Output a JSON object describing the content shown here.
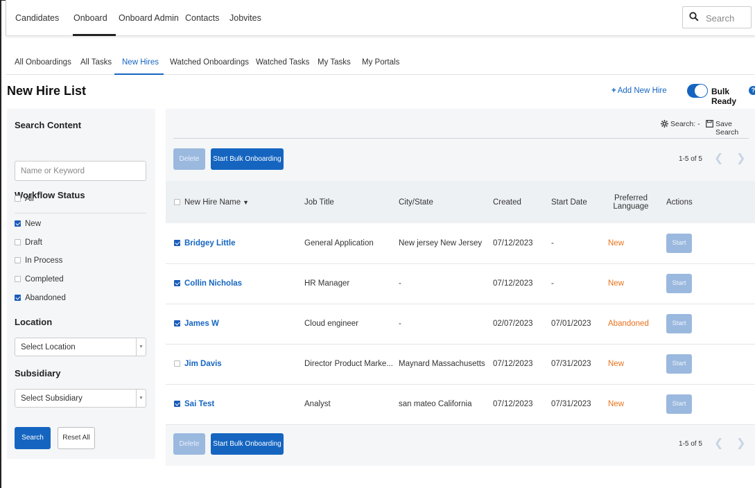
{
  "topnav": {
    "items": [
      "Candidates",
      "Onboard",
      "Onboard Admin",
      "Contacts",
      "Jobvites"
    ],
    "search_placeholder": "Search"
  },
  "subtabs": [
    "All Onboardings",
    "All Tasks",
    "New Hires",
    "Watched Onboardings",
    "Watched Tasks",
    "My Tasks",
    "My Portals"
  ],
  "active_subtab": "New Hires",
  "page_title": "New Hire List",
  "header_actions": {
    "add_new_hire": "Add New Hire",
    "bulk_ready": "Bulk Ready",
    "bulk_ready_on": true
  },
  "filters": {
    "search_content_label": "Search Content",
    "keyword_placeholder": "Name or Keyword",
    "workflow_status_label": "Workflow Status",
    "statuses": [
      {
        "label": "All",
        "checked": false
      },
      {
        "label": "New",
        "checked": true
      },
      {
        "label": "Draft",
        "checked": false
      },
      {
        "label": "In Process",
        "checked": false
      },
      {
        "label": "Completed",
        "checked": false
      },
      {
        "label": "Abandoned",
        "checked": true
      }
    ],
    "location_label": "Location",
    "location_value": "Select Location",
    "subsidiary_label": "Subsidiary",
    "subsidiary_value": "Select Subsidiary",
    "search_button": "Search",
    "reset_button": "Reset All"
  },
  "list": {
    "search_label": "Search: -",
    "save_search": "Save Search",
    "delete_button": "Delete",
    "start_bulk_button": "Start Bulk Onboarding",
    "pager": "1-5 of 5",
    "columns": {
      "name": "New Hire Name",
      "job_title": "Job Title",
      "city_state": "City/State",
      "created": "Created",
      "start_date": "Start Date",
      "preferred_language": "Preferred Language",
      "actions": "Actions"
    },
    "rows": [
      {
        "name": "Bridgey Little",
        "job_title": "General Application",
        "city_state": "New jersey New Jersey",
        "created": "07/12/2023",
        "start_date": "-",
        "status": "New",
        "action": "Start",
        "checked": true
      },
      {
        "name": "Collin Nicholas",
        "job_title": "HR Manager",
        "city_state": "-",
        "created": "07/12/2023",
        "start_date": "-",
        "status": "New",
        "action": "Start",
        "checked": true
      },
      {
        "name": "James W",
        "job_title": "Cloud engineer",
        "city_state": "-",
        "created": "02/07/2023",
        "start_date": "07/01/2023",
        "status": "Abandoned",
        "action": "Start",
        "checked": true
      },
      {
        "name": "Jim Davis",
        "job_title": "Director Product Marke...",
        "city_state": "Maynard Massachusetts",
        "created": "07/12/2023",
        "start_date": "07/31/2023",
        "status": "New",
        "action": "Start",
        "checked": false
      },
      {
        "name": "Sai Test",
        "job_title": "Analyst",
        "city_state": "san mateo California",
        "created": "07/12/2023",
        "start_date": "07/31/2023",
        "status": "New",
        "action": "Start",
        "checked": true
      }
    ]
  },
  "colors": {
    "primary": "#1565c0",
    "status_orange": "#e8711a",
    "disabled_blue": "#9bb9df",
    "panel_bg": "#f4f6f8"
  }
}
